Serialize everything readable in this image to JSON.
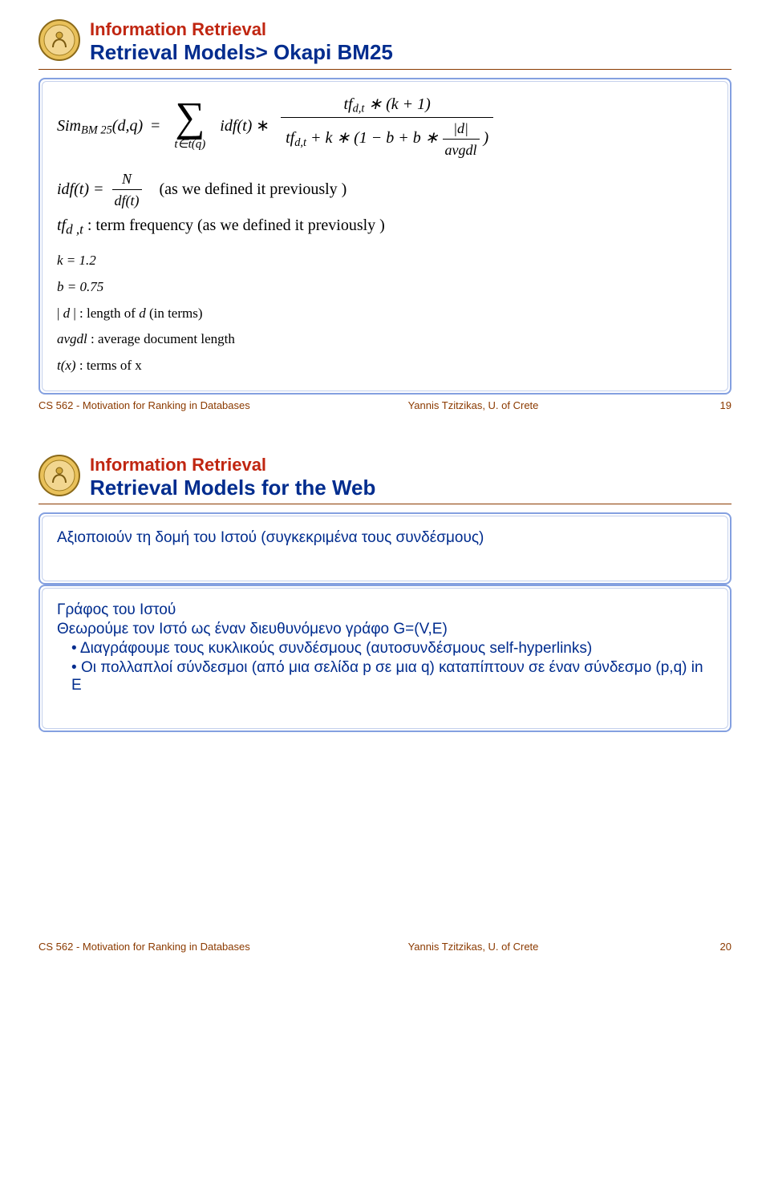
{
  "slide19": {
    "supertitle": "Information Retrieval",
    "subtitle": "Retrieval Models> Okapi BM25",
    "math_main_lhs": "Sim",
    "math_main_sub": "BM 25",
    "math_main_args": "(d,q)",
    "equals": "=",
    "sigma_range": "t∈t(q)",
    "idft": "idf(t)",
    "ast": "∗",
    "frac_big_num_a": "tf",
    "frac_big_num_sub": "d,t",
    "frac_big_num_b": " ∗ (k + 1)",
    "frac_big_den_a": "tf",
    "frac_big_den_sub": "d,t",
    "frac_big_den_b": " + k  ∗ (1 − b + b ∗ ",
    "frac_dl_num": "|d|",
    "frac_dl_den": "avgdl",
    "frac_big_den_c": " )",
    "idf_def_lhs": "idf(t) = ",
    "idf_def_N": "N",
    "idf_def_dft": "df(t)",
    "idf_def_note": "(as  we  defined  it  previously  )",
    "tfd_lhs": "tf",
    "tfd_sub": "d ,t",
    "tfd_note": " :  term   frequency    (as  we  defined   it  previously   )",
    "k_line": "k = 1.2",
    "b_line": "b = 0.75",
    "d_line": "| d | : length of d (in terms)",
    "avgdl_line": "avgdl : average document length",
    "tx_line": "t(x) :  terms of  x",
    "footer_left": "CS 562 - Motivation for Ranking in Databases",
    "footer_mid": "Yannis Tzitzikas, U. of Crete",
    "footer_right": "19"
  },
  "slide20": {
    "supertitle": "Information Retrieval",
    "subtitle": "Retrieval Models for the Web",
    "lines": {
      "l0": "Αξιοποιούν τη δομή του Ιστού (συγκεκριμένα τους συνδέσμους)",
      "l1": "Γράφος του Ιστού",
      "l2": "Θεωρούμε τον Ιστό ως έναν διευθυνόμενο γράφο G=(V,E)",
      "l3": "Διαγράφουμε τους κυκλικούς συνδέσμους (αυτοσυνδέσμους  self-hyperlinks)",
      "l4": "Οι πολλαπλοί σύνδεσμοι (από μια σελίδα p σε μια q) καταπίπτουν σε έναν σύνδεσμο (p,q) in E"
    },
    "bullet": "•  ",
    "footer_left": "CS 562 - Motivation for Ranking in Databases",
    "footer_mid": "Yannis Tzitzikas, U. of Crete",
    "footer_right": "20"
  }
}
